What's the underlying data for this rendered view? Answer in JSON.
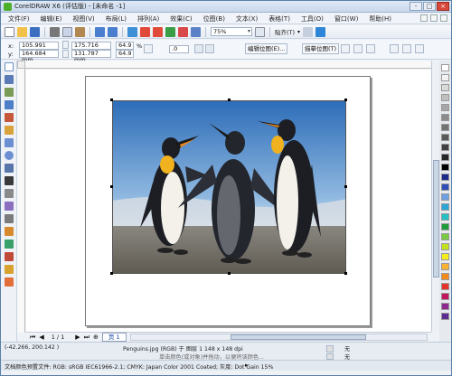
{
  "window": {
    "title": "CorelDRAW X6 (评估版) - [未命名 -1]",
    "controls": [
      "-",
      "□",
      "×"
    ]
  },
  "menu": [
    "文件(F)",
    "编辑(E)",
    "视图(V)",
    "布局(L)",
    "排列(A)",
    "效果(C)",
    "位图(B)",
    "文本(X)",
    "表格(T)",
    "工具(O)",
    "窗口(W)",
    "帮助(H)"
  ],
  "toolbar": {
    "zoom": "75%",
    "snap_label": "贴齐(T)"
  },
  "property_bar": {
    "x": "105.991 mm",
    "y": "164.684 mm",
    "width": "175.716 mm",
    "height": "131.787 mm",
    "scale_w": "64.9",
    "scale_h": "64.9",
    "percent": "%",
    "rotation": ".0",
    "edit_bitmap": "编辑位图(E)...",
    "trace_bitmap": "描摹位图(T)"
  },
  "page_nav": {
    "count": "1 / 1",
    "tab": "页 1"
  },
  "status": {
    "coords": "(-42.266, 200.142 )",
    "object_info": "Penguins.jpg (RGB) 于 图层 1 148 x 148 dpi",
    "hint": "单击对象两次可旋转/倾斜；双击工具可选择所有对象；按住 Shift 键单击可选择多个对象；按住 Alt 键单击可进行挖掘",
    "hint_short": "单击颜色(或对象)并拖动，以便将该颜色...",
    "profile": "文档颜色预置文件: RGB: sRGB IEC61966-2.1; CMYK: Japan Color 2001 Coated; 灰度: Dot Gain 15%",
    "fill_none": "无",
    "outline_none": "无"
  },
  "palette_colors": [
    "#ffffff",
    "#f2f2f2",
    "#d9d9d9",
    "#bfbfbf",
    "#a6a6a6",
    "#8c8c8c",
    "#737373",
    "#595959",
    "#404040",
    "#262626",
    "#000000",
    "#1e2a8a",
    "#2f4fb5",
    "#6e9fe0",
    "#2aa6d6",
    "#22c1c3",
    "#1f9b3a",
    "#7ac943",
    "#c5e01f",
    "#f4ec1d",
    "#f9b233",
    "#f28a1c",
    "#e6332a",
    "#c2185b",
    "#8e2a8e",
    "#5b2d90"
  ]
}
